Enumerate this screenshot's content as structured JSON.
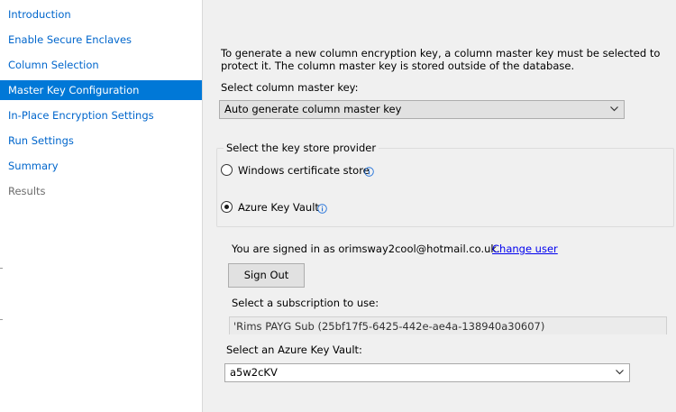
{
  "sidebar": {
    "items": [
      {
        "label": "Introduction"
      },
      {
        "label": "Enable Secure Enclaves"
      },
      {
        "label": "Column Selection"
      },
      {
        "label": "Master Key Configuration"
      },
      {
        "label": "In-Place Encryption Settings"
      },
      {
        "label": "Run Settings"
      },
      {
        "label": "Summary"
      },
      {
        "label": "Results"
      }
    ],
    "selected": "Master Key Configuration"
  },
  "main": {
    "description": "To generate a new column encryption key, a column master key must be selected to protect it.  The column master key is stored outside of the database.",
    "cmk_label": "Select column master key:",
    "cmk_value": "Auto generate column master key",
    "keystore": {
      "legend": "Select the key store provider",
      "options": [
        {
          "label": "Windows certificate store",
          "selected": false,
          "icon": "info-icon"
        },
        {
          "label": "Azure Key Vault",
          "selected": true,
          "icon": "info-icon"
        }
      ]
    },
    "signed_in_text": "You are signed in as orimsway2cool@hotmail.co.uk.",
    "change_user_link": "Change user",
    "sign_out_button": "Sign Out",
    "subscription_label": "Select a subscription to use:",
    "subscription_value": "'Rims PAYG Sub (25bf17f5-6425-442e-ae4a-138940a30607)",
    "keyvault_label": "Select an Azure Key Vault:",
    "keyvault_value": "a5w2cKV"
  },
  "colors": {
    "selection": "#0078d7",
    "link": "#0066cc",
    "info_icon": "#1e6fd9"
  }
}
